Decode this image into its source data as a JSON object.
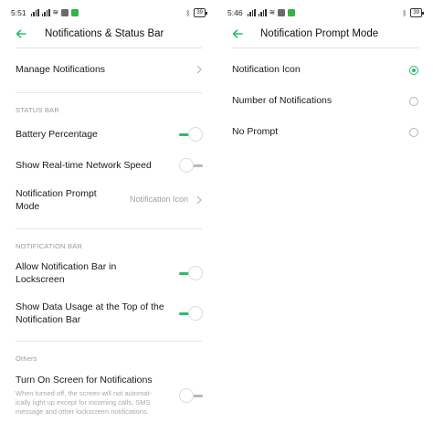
{
  "accent_color": "#2bbb6b",
  "left": {
    "status_bar": {
      "time": "5:51",
      "battery": "39"
    },
    "header": {
      "title": "Notifications & Status Bar",
      "back_icon": "back-arrow-icon"
    },
    "manage_notifications": {
      "label": "Manage Notifications"
    },
    "status_bar_section": {
      "header": "STATUS BAR",
      "battery_percentage": {
        "label": "Battery Percentage",
        "on": true
      },
      "network_speed": {
        "label": "Show Real-time Network Speed",
        "on": false
      },
      "prompt_mode": {
        "label_line1": "Notification Prompt",
        "label_line2": "Mode",
        "value": "Notification Icon"
      }
    },
    "notification_bar_section": {
      "header": "NOTIFICATION BAR",
      "allow_lockscreen": {
        "label_line1": "Allow Notification Bar in",
        "label_line2": "Lockscreen",
        "on": true
      },
      "data_usage": {
        "label_line1": "Show Data Usage at the Top of the",
        "label_line2": "Notification Bar",
        "on": true
      }
    },
    "others_section": {
      "header": "Others",
      "screen_on": {
        "label": "Turn On Screen for Notifications",
        "desc_line1": "When turned off, the screen will not automat-",
        "desc_line2": "ically light up except for incoming calls, SMS",
        "desc_line3": "message and other lockscreen notifications.",
        "on": false
      }
    }
  },
  "right": {
    "status_bar": {
      "time": "5:46",
      "battery": "39"
    },
    "header": {
      "title": "Notification Prompt Mode",
      "back_icon": "back-arrow-icon"
    },
    "options": [
      {
        "label": "Notification Icon",
        "selected": true
      },
      {
        "label": "Number of Notifications",
        "selected": false
      },
      {
        "label": "No Prompt",
        "selected": false
      }
    ]
  }
}
